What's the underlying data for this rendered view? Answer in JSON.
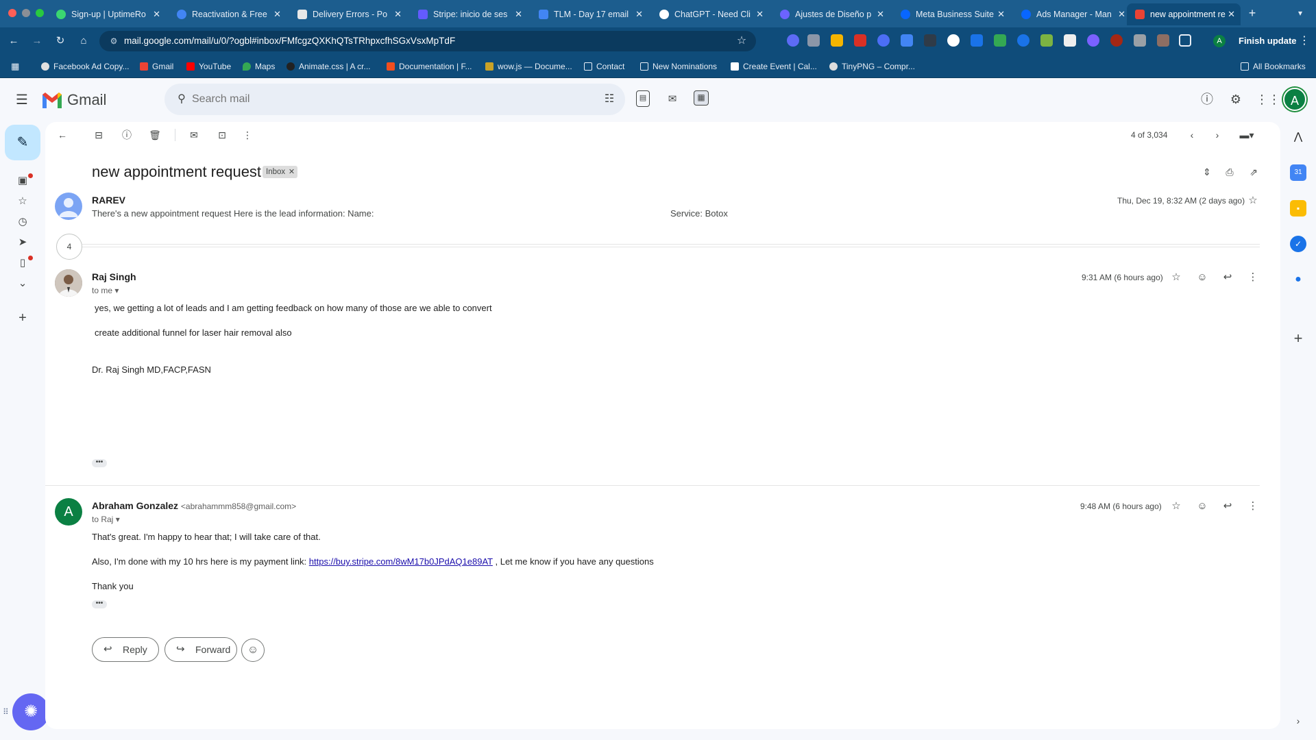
{
  "browser": {
    "tabs": [
      {
        "title": "Sign-up | UptimeRo",
        "fav": "#3bd671"
      },
      {
        "title": "Reactivation & Free",
        "fav": "#4285f4"
      },
      {
        "title": "Delivery Errors - Po",
        "fav": "#e8e8e8"
      },
      {
        "title": "Stripe: inicio de ses",
        "fav": "#635bff"
      },
      {
        "title": "TLM - Day 17 email",
        "fav": "#4285f4"
      },
      {
        "title": "ChatGPT - Need Cli",
        "fav": "#ffffff"
      },
      {
        "title": "Ajustes de Diseño p",
        "fav": "#6c63ff"
      },
      {
        "title": "Meta Business Suite",
        "fav": "#0866ff"
      },
      {
        "title": "Ads Manager - Man",
        "fav": "#0866ff"
      },
      {
        "title": "new appointment re",
        "fav": "#ea4335",
        "active": true
      }
    ],
    "new_tab": "+",
    "url": "mail.google.com/mail/u/0/?ogbl#inbox/FMfcgzQXKhQTsTRhpxcfhSGxVsxMpTdF",
    "finish_update": "Finish update",
    "profile_initial": "A",
    "bookmarks": [
      {
        "label": "Facebook Ad Copy...",
        "color": "#e0e0e0"
      },
      {
        "label": "Gmail",
        "color": "#ea4335"
      },
      {
        "label": "YouTube",
        "color": "#ff0000"
      },
      {
        "label": "Maps",
        "color": "#34a853"
      },
      {
        "label": "Animate.css | A cr...",
        "color": "#222222"
      },
      {
        "label": "Documentation | F...",
        "color": "#f24e1e"
      },
      {
        "label": "wow.js — Docume...",
        "color": "#c9a227"
      },
      {
        "label": "Contact",
        "color": "folder"
      },
      {
        "label": "New Nominations",
        "color": "folder"
      },
      {
        "label": "Create Event | Cal...",
        "color": "#ffffff"
      },
      {
        "label": "TinyPNG – Compr...",
        "color": "#dddddd"
      }
    ],
    "all_bookmarks": "All Bookmarks"
  },
  "gmail": {
    "logo_text": "Gmail",
    "search_placeholder": "Search mail",
    "account_initial": "A",
    "counter": "4 of 3,034",
    "subject": "new appointment request",
    "label": "Inbox",
    "collapsed_count": "4",
    "messages": [
      {
        "sender": "RAREV",
        "snippet": "There's a new appointment request Here is the lead information: Name:",
        "snippet2": "Service: Botox",
        "time": "Thu, Dec 19, 8:32 AM (2 days ago)"
      },
      {
        "sender": "Raj Singh",
        "to": "to me",
        "time": "9:31 AM (6 hours ago)",
        "lines": [
          "yes, we getting a lot of leads and I am getting feedback on how many of those are we able to convert",
          "create additional funnel for laser hair removal also",
          "Dr. Raj Singh MD,FACP,FASN"
        ]
      },
      {
        "sender": "Abraham Gonzalez",
        "email": "<abrahammm858@gmail.com>",
        "avatar_initial": "A",
        "to": "to Raj",
        "time": "9:48 AM (6 hours ago)",
        "line1": "That's great. I'm happy to hear that; I will take care of that.",
        "line2_pre": "Also, I'm done with my 10 hrs here is my payment link: ",
        "line2_link": "https://buy.stripe.com/8wM17b0JPdAQ1e89AT",
        "line2_post": " , Let me know if you have any questions",
        "line3": "Thank you"
      }
    ],
    "reply_label": "Reply",
    "forward_label": "Forward"
  },
  "colors": {
    "accent": "#0b57d0",
    "compose": "#c2e7ff",
    "avatar_green": "#0b8043",
    "avatar_blue": "#7ba4f4"
  }
}
